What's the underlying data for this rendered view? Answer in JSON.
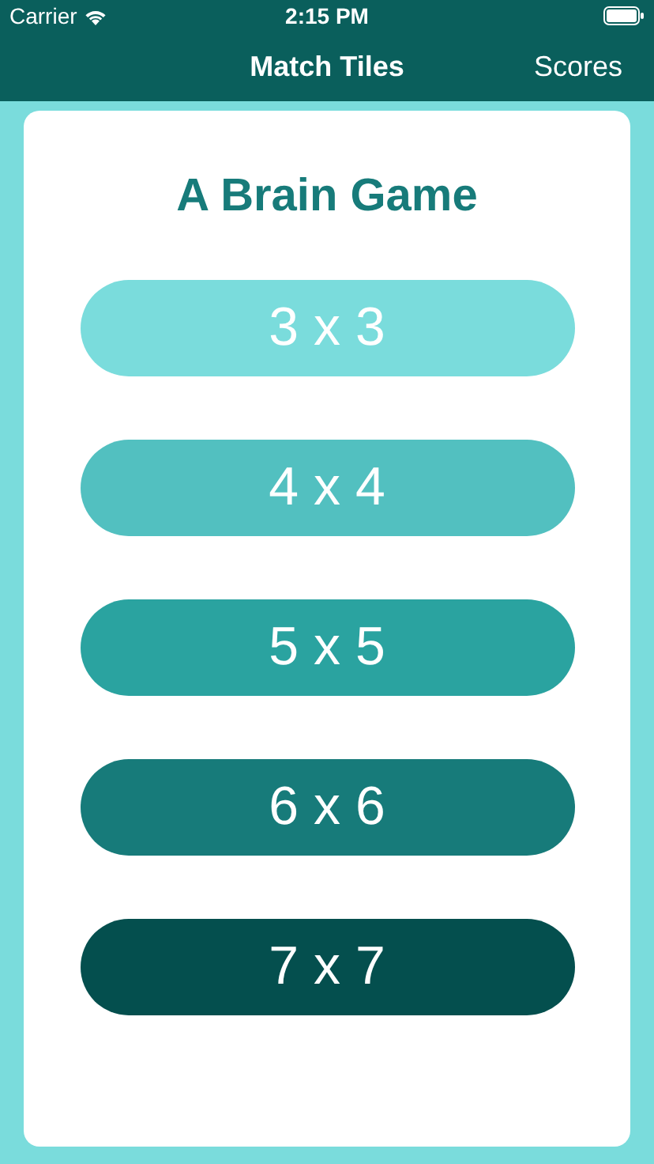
{
  "status_bar": {
    "carrier": "Carrier",
    "time": "2:15 PM"
  },
  "nav_bar": {
    "title": "Match Tiles",
    "right_button": "Scores"
  },
  "card": {
    "title": "A Brain Game",
    "options": [
      {
        "label": "3 x 3",
        "color": "#7adcdc"
      },
      {
        "label": "4 x 4",
        "color": "#52c0c0"
      },
      {
        "label": "5 x 5",
        "color": "#2aa3a0"
      },
      {
        "label": "6 x 6",
        "color": "#177b7a"
      },
      {
        "label": "7 x 7",
        "color": "#044f4e"
      }
    ]
  }
}
